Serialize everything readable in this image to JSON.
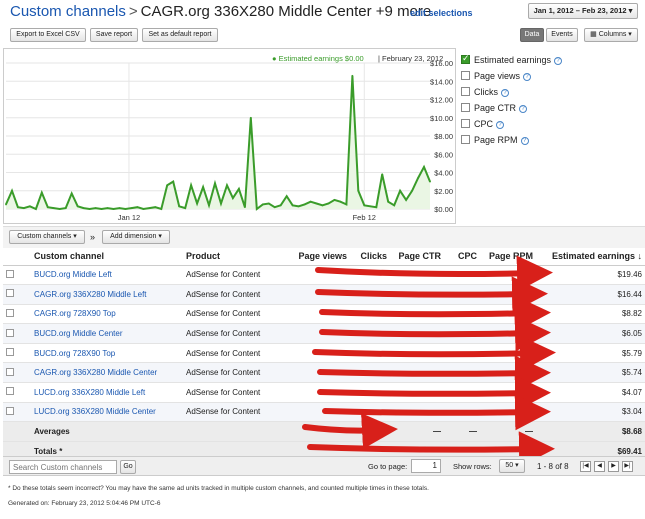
{
  "header": {
    "breadcrumb": "Custom channels",
    "separator": ">",
    "title": "CAGR.org 336X280 Middle Center +9 more",
    "edit_link": "edit selections",
    "date_range": "Jan 1, 2012 – Feb 23, 2012 ▾"
  },
  "toolbar": {
    "export_label": "Export to Excel CSV",
    "save_label": "Save report",
    "default_label": "Set as default report",
    "data_tab": "Data",
    "events_tab": "Events",
    "columns_label": "Columns ▾"
  },
  "chart_data": {
    "type": "line",
    "legend": "Estimated earnings $0.00",
    "legend_date": "February 23, 2012",
    "x_labels": [
      "Jan 12",
      "Feb 12"
    ],
    "y_ticks": [
      "$16.00",
      "$14.00",
      "$12.00",
      "$10.00",
      "$8.00",
      "$6.00",
      "$4.00",
      "$2.00",
      "$0.00"
    ],
    "ylim": [
      0,
      16
    ],
    "values": [
      0.5,
      2.0,
      0.2,
      0.1,
      0.3,
      0.0,
      1.8,
      0.2,
      0.1,
      0.0,
      0.1,
      1.7,
      0.3,
      0.1,
      0.0,
      0.1,
      0.0,
      0.1,
      0.0,
      0.1,
      0.0,
      0.1,
      0.2,
      0.0,
      0.1,
      0.2,
      0.0,
      2.6,
      3.0,
      0.3,
      0.1,
      2.6,
      0.6,
      2.4,
      0.4,
      2.8,
      0.6,
      2.6,
      1.2,
      2.2,
      0.2,
      10.0,
      0.0,
      0.5,
      0.6,
      0.2,
      0.4,
      1.4,
      0.4,
      0.3,
      0.5,
      0.8,
      0.6,
      0.4,
      0.6,
      1.0,
      0.8,
      0.5,
      14.6,
      2.0,
      0.4,
      0.3,
      0.2,
      3.8,
      0.8,
      0.4,
      2.0,
      1.0,
      2.0,
      3.4,
      4.6,
      3.0
    ],
    "grid": true,
    "line_color": "#3a9c2a"
  },
  "metrics": [
    {
      "label": "Estimated earnings",
      "checked": true
    },
    {
      "label": "Page views",
      "checked": false
    },
    {
      "label": "Clicks",
      "checked": false
    },
    {
      "label": "Page CTR",
      "checked": false
    },
    {
      "label": "CPC",
      "checked": false
    },
    {
      "label": "Page RPM",
      "checked": false
    }
  ],
  "filters": {
    "dropdown": "Custom channels ▾",
    "arrow": "»",
    "add_dimension": "Add dimension ▾"
  },
  "table": {
    "columns": [
      "Custom channel",
      "Product",
      "Page views",
      "Clicks",
      "Page CTR",
      "CPC",
      "Page RPM",
      "Estimated earnings ↓"
    ],
    "rows": [
      {
        "channel": "BUCD.org Middle Left",
        "product": "AdSense for Content",
        "earnings": "$19.46"
      },
      {
        "channel": "CAGR.org 336X280 Middle Left",
        "product": "AdSense for Content",
        "earnings": "$16.44"
      },
      {
        "channel": "CAGR.org 728X90 Top",
        "product": "AdSense for Content",
        "earnings": "$8.82"
      },
      {
        "channel": "BUCD.org Middle Center",
        "product": "AdSense for Content",
        "earnings": "$6.05"
      },
      {
        "channel": "BUCD.org 728X90 Top",
        "product": "AdSense for Content",
        "earnings": "$5.79"
      },
      {
        "channel": "CAGR.org 336X280 Middle Center",
        "product": "AdSense for Content",
        "earnings": "$5.74"
      },
      {
        "channel": "LUCD.org 336X280 Middle Left",
        "product": "AdSense for Content",
        "earnings": "$4.07"
      },
      {
        "channel": "LUCD.org 336X280 Middle Center",
        "product": "AdSense for Content",
        "earnings": "$3.04"
      }
    ],
    "averages_label": "Averages",
    "averages_dashes": [
      "—",
      "—",
      "—"
    ],
    "averages_earnings": "$8.68",
    "totals_label": "Totals *",
    "totals_earnings": "$69.41"
  },
  "footer": {
    "search_placeholder": "Search Custom channels",
    "go_label": "Go",
    "goto_label": "Go to page:",
    "page_value": "1",
    "show_rows_label": "Show rows:",
    "rows_value": "50 ▾",
    "range_text": "1 - 8 of 8",
    "note": "* Do these totals seem incorrect? You may have the same ad units tracked in multiple custom channels, and counted multiple times in these totals.",
    "generated": "Generated on: February 23, 2012 5:04:46 PM UTC-6"
  },
  "colors": {
    "redaction": "#d8201a",
    "link": "#1a57b0"
  }
}
